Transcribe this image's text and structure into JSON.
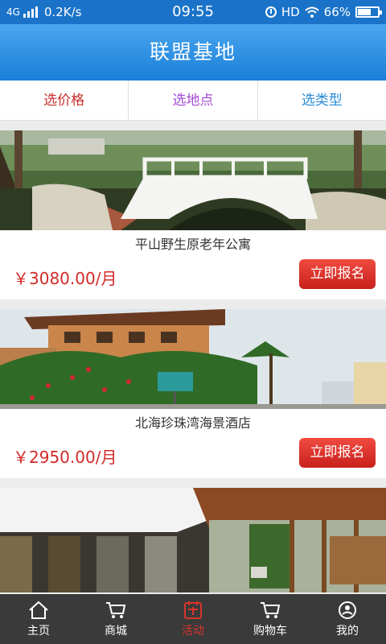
{
  "status_bar": {
    "network": "4G",
    "speed": "0.2K/s",
    "time": "09:55",
    "hd": "HD",
    "battery_text": "66%",
    "battery_level": 0.66
  },
  "header": {
    "title": "联盟基地"
  },
  "filters": [
    {
      "label": "选价格",
      "color": "#c9302c"
    },
    {
      "label": "选地点",
      "color": "#a44ad4"
    },
    {
      "label": "选类型",
      "color": "#2a8bd6"
    }
  ],
  "listings": [
    {
      "name": "平山野生原老年公寓",
      "price": "￥3080.00/月",
      "button": "立即报名"
    },
    {
      "name": "北海珍珠湾海景酒店",
      "price": "￥2950.00/月",
      "button": "立即报名"
    }
  ],
  "tabbar": {
    "tabs": [
      {
        "label": "主页",
        "icon": "home-icon"
      },
      {
        "label": "商城",
        "icon": "cart-icon"
      },
      {
        "label": "活动",
        "icon": "activity-icon"
      },
      {
        "label": "购物车",
        "icon": "cart-icon"
      },
      {
        "label": "我的",
        "icon": "user-icon"
      }
    ],
    "active_index": 2,
    "active_color": "#d9342b"
  }
}
